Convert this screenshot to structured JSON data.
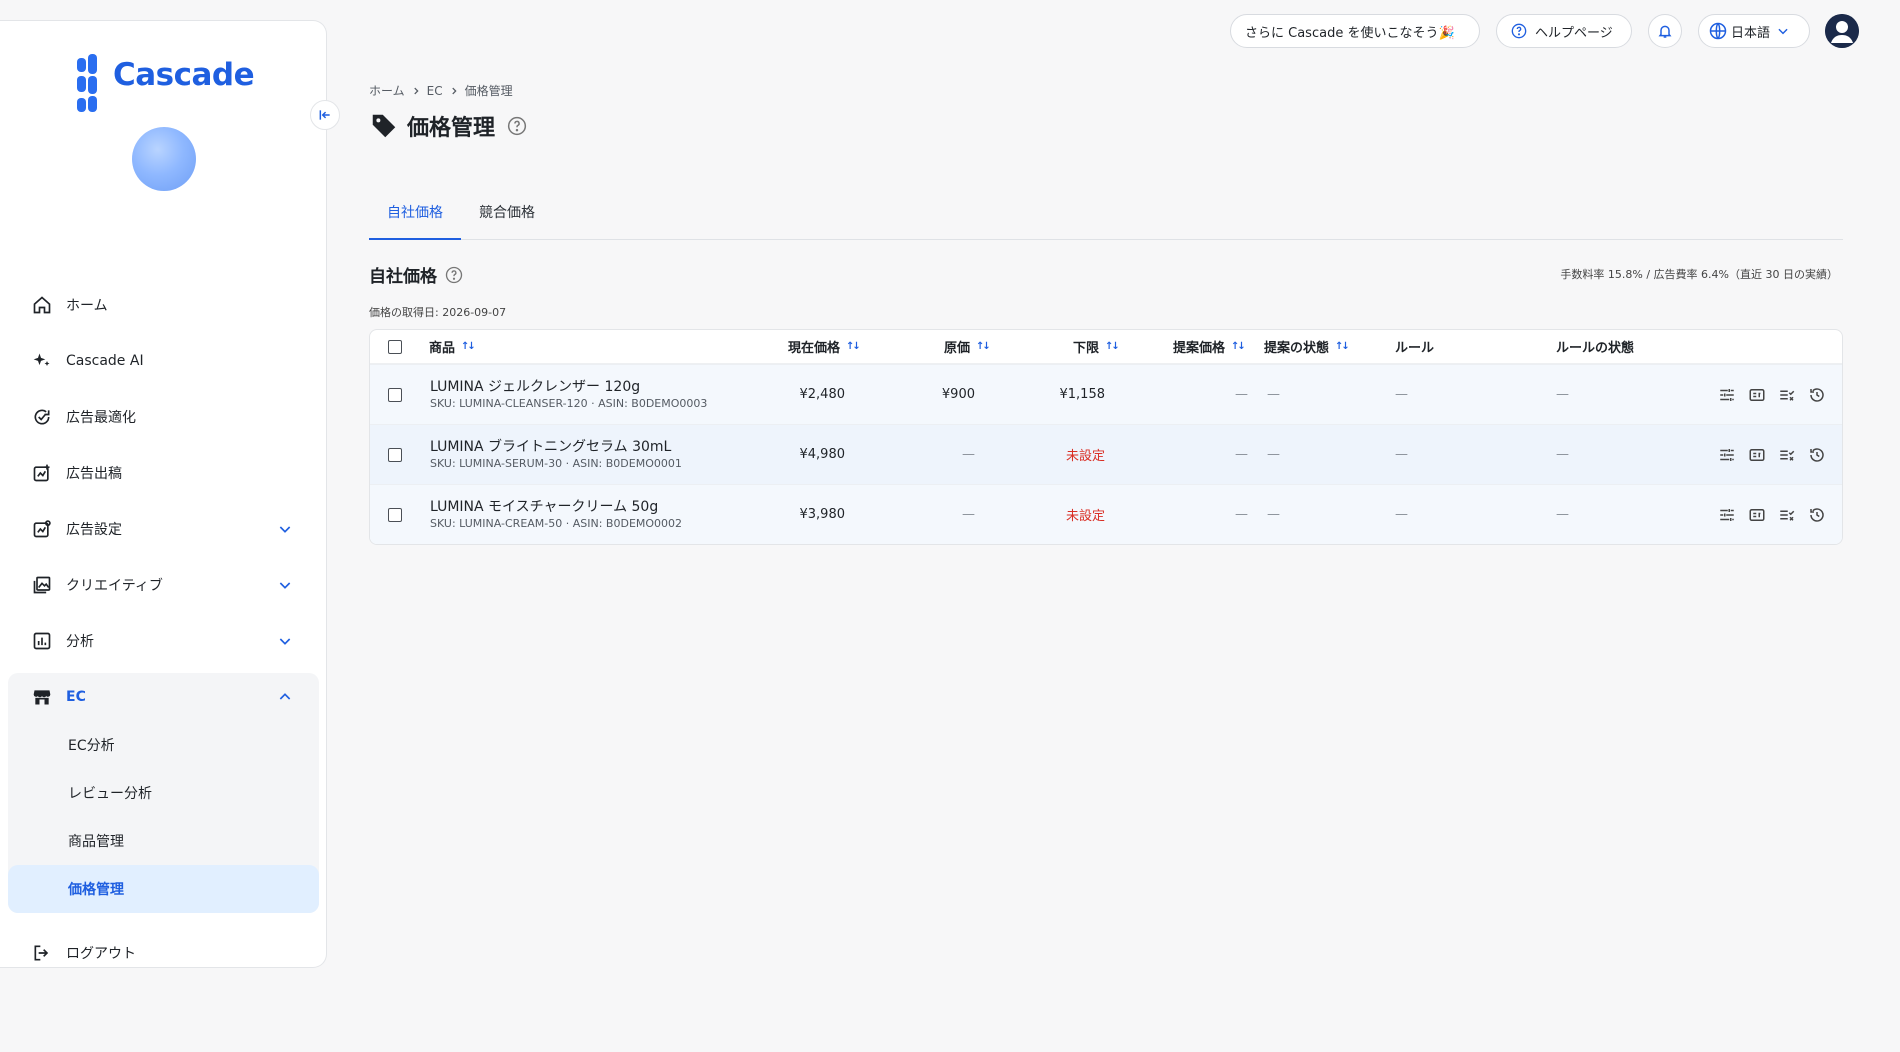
{
  "app": {
    "name": "Cascade"
  },
  "header": {
    "promo": "さらに Cascade を使いこなそう🎉",
    "help": "ヘルプページ",
    "language": "日本語"
  },
  "sidebar": {
    "items": [
      {
        "label": "ホーム",
        "icon": "home-icon"
      },
      {
        "label": "Cascade AI",
        "icon": "sparkle-icon"
      },
      {
        "label": "広告最適化",
        "icon": "optimize-icon"
      },
      {
        "label": "広告出稿",
        "icon": "publish-icon"
      },
      {
        "label": "広告設定",
        "icon": "ad-settings-icon"
      },
      {
        "label": "クリエイティブ",
        "icon": "image-icon"
      },
      {
        "label": "分析",
        "icon": "chart-icon"
      }
    ],
    "ec_group": {
      "label": "EC",
      "icon": "store-icon",
      "subitems": [
        "EC分析",
        "レビュー分析",
        "商品管理",
        "価格管理"
      ],
      "active": "価格管理"
    },
    "logout": "ログアウト"
  },
  "breadcrumb": [
    "ホーム",
    "EC",
    "価格管理"
  ],
  "page": {
    "title": "価格管理"
  },
  "tabs": [
    {
      "label": "自社価格",
      "active": true
    },
    {
      "label": "競合価格",
      "active": false
    }
  ],
  "section": {
    "title": "自社価格",
    "fee_text": "手数料率 15.8% / 広告費率 6.4%（直近 30 日の実績）",
    "fetch_date": "価格の取得日: 2026-09-07"
  },
  "table": {
    "columns": [
      "商品",
      "現在価格",
      "原価",
      "下限",
      "提案価格",
      "提案の状態",
      "ルール",
      "ルールの状態"
    ],
    "rows": [
      {
        "name": "LUMINA ジェルクレンザー 120g",
        "sku": "SKU: LUMINA-CLEANSER-120 · ASIN: B0DEMO0003",
        "current": "¥2,480",
        "cost": "¥900",
        "floor": "¥1,158",
        "proposed": "—",
        "proposal_status": "—",
        "rule": "—",
        "rule_status": "—"
      },
      {
        "name": "LUMINA ブライトニングセラム 30mL",
        "sku": "SKU: LUMINA-SERUM-30 · ASIN: B0DEMO0001",
        "current": "¥4,980",
        "cost": "—",
        "floor": "未設定",
        "proposed": "—",
        "proposal_status": "—",
        "rule": "—",
        "rule_status": "—"
      },
      {
        "name": "LUMINA モイスチャークリーム 50g",
        "sku": "SKU: LUMINA-CREAM-50 · ASIN: B0DEMO0002",
        "current": "¥3,980",
        "cost": "—",
        "floor": "未設定",
        "proposed": "—",
        "proposal_status": "—",
        "rule": "—",
        "rule_status": "—"
      }
    ]
  },
  "colors": {
    "accent": "#1f5fe0",
    "warning": "#d93026",
    "active_bg": "#e1efff"
  }
}
